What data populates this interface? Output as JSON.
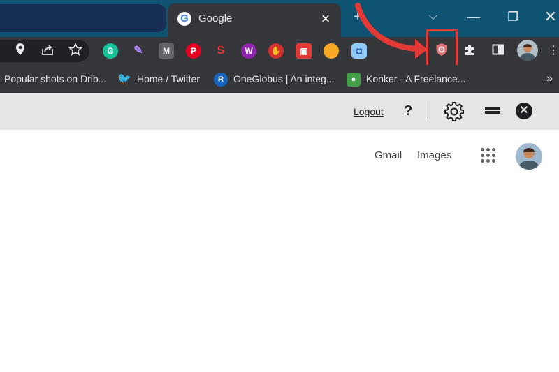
{
  "tab": {
    "title": "Google",
    "favicon": "google-g-icon"
  },
  "window_controls": [
    "minimize-icon",
    "restore-icon",
    "close-icon"
  ],
  "toolbar": {
    "icons": [
      "location-pin-icon",
      "share-icon",
      "star-icon"
    ],
    "extensions": [
      {
        "name": "grammarly-icon",
        "color": "#15c39a",
        "glyph": "G"
      },
      {
        "name": "feather-icon",
        "color": "#8e5fd6",
        "glyph": "✎"
      },
      {
        "name": "mail-m-icon",
        "color": "#5f6368",
        "glyph": "M"
      },
      {
        "name": "pinterest-icon",
        "color": "#e60023",
        "glyph": "P"
      },
      {
        "name": "seo-icon",
        "color": "#c62828",
        "glyph": "S"
      },
      {
        "name": "w-extension-icon",
        "color": "#8e24aa",
        "glyph": "W"
      },
      {
        "name": "hand-stop-icon",
        "color": "#d32f2f",
        "glyph": "✋"
      },
      {
        "name": "tasks-icon",
        "color": "#e53935",
        "glyph": "▣"
      },
      {
        "name": "coin-icon",
        "color": "#f9a825",
        "glyph": "●"
      },
      {
        "name": "screen-capture-icon",
        "color": "#90caf9",
        "glyph": "◘"
      }
    ],
    "highlighted_extension": "shield-extension-icon",
    "accent_red": "#e53935"
  },
  "bookmarks": [
    {
      "label": "Popular shots on Drib...",
      "icon": ""
    },
    {
      "label": "Home / Twitter",
      "icon": "twitter-icon",
      "color": "#1da1f2"
    },
    {
      "label": "OneGlobus | An integ...",
      "icon": "oneglobus-icon",
      "color": "#1565c0"
    },
    {
      "label": "Konker - A Freelance...",
      "icon": "konker-icon",
      "color": "#43a047"
    }
  ],
  "bookmarks_more": "»",
  "extension_bar": {
    "logout": "Logout",
    "help": "?"
  },
  "google": {
    "gmail": "Gmail",
    "images": "Images"
  }
}
